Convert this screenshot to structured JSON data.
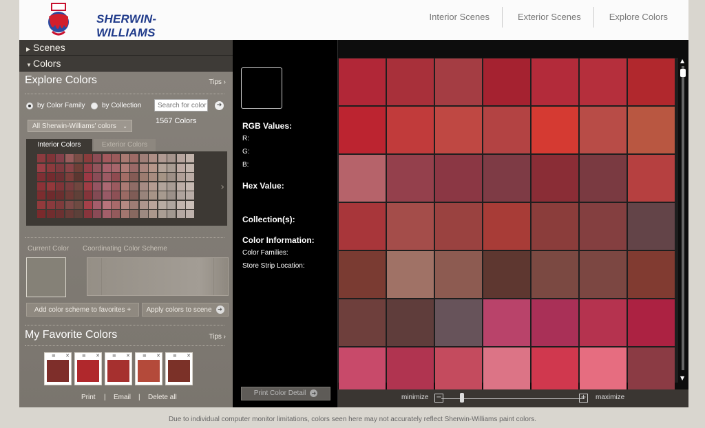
{
  "header": {
    "brand": "SHERWIN-WILLIAMS",
    "nav": [
      "Interior Scenes",
      "Exterior Scenes",
      "Explore Colors"
    ]
  },
  "left": {
    "accordion": [
      {
        "label": "Scenes",
        "expanded": false
      },
      {
        "label": "Colors",
        "expanded": true
      }
    ],
    "explore": {
      "title": "Explore Colors",
      "tips": "Tips",
      "radio_family": "by Color Family",
      "radio_collection": "by Collection",
      "search_placeholder": "Search for color",
      "select_value": "All Sherwin-Williams' colors",
      "count": "1567 Colors",
      "tab_interior": "Interior Colors",
      "tab_exterior": "Exterior Colors",
      "current_color_label": "Current Color",
      "scheme_label": "Coordinating Color Scheme",
      "btn_add": "Add color scheme to favorites",
      "btn_apply": "Apply colors to scene"
    },
    "favorites": {
      "title": "My Favorite Colors",
      "tips": "Tips",
      "colors": [
        "#7e2e2a",
        "#b0282c",
        "#a6302f",
        "#b44a3a",
        "#7b3128"
      ],
      "links": [
        "Print",
        "Email",
        "Delete all"
      ],
      "separator": "|"
    }
  },
  "info": {
    "rgb_title": "RGB Values:",
    "r": "R:",
    "g": "G:",
    "b": "B:",
    "hex_title": "Hex Value:",
    "collections_title": "Collection(s):",
    "color_info_title": "Color Information:",
    "families": "Color Families:",
    "strip": "Store Strip Location:",
    "print_button": "Print Color Detail"
  },
  "zoom": {
    "minimize": "minimize",
    "maximize": "maximize",
    "level": 0.15
  },
  "grid_colors": [
    [
      "#b12737",
      "#a8303a",
      "#a43d43",
      "#a52230",
      "#b32b3a",
      "#b52f3c",
      "#b1282d"
    ],
    [
      "#bc2430",
      "#c13b3b",
      "#bf4843",
      "#b34343",
      "#d53a32",
      "#b84c47",
      "#b95741"
    ],
    [
      "#b6636a",
      "#94404c",
      "#8b3744",
      "#7e3b45",
      "#8a2d36",
      "#7a3a41",
      "#b64040"
    ],
    [
      "#a8363a",
      "#a44d4a",
      "#9a4240",
      "#a83c37",
      "#8b3d3b",
      "#843f40",
      "#634448"
    ],
    [
      "#7a3b32",
      "#a07266",
      "#8d5b51",
      "#5e3730",
      "#7b4942",
      "#7c4742",
      "#813b31"
    ],
    [
      "#6e3f3c",
      "#5f3d3b",
      "#67535a",
      "#b9436a",
      "#a93057",
      "#b5334f",
      "#ac2242"
    ],
    [
      "#c84a6a",
      "#b03450",
      "#c44b5e",
      "#dc7486",
      "#d0384e",
      "#e66d80",
      "#8b3b44"
    ]
  ],
  "mini_grid_colors": [
    [
      "#8b3b3f",
      "#7f3438",
      "#83404a",
      "#985c5c",
      "#7a4c45",
      "#8a3c3c",
      "#8d4c55",
      "#a3595d",
      "#9a5b5b",
      "#a97a72",
      "#9e6b66",
      "#9f7f78",
      "#ad8e85",
      "#b09a92",
      "#a5948c",
      "#b7a59e",
      "#c1b2aa"
    ],
    [
      "#9a3f46",
      "#8c3a3d",
      "#7e3a3f",
      "#8a4448",
      "#6f3f37",
      "#943e47",
      "#92545c",
      "#a8616c",
      "#a6666b",
      "#b07c77",
      "#9a6967",
      "#a9857d",
      "#b59689",
      "#b3a398",
      "#a89c92",
      "#bdaaa3",
      "#c4b6ae"
    ],
    [
      "#7e2f34",
      "#742b2f",
      "#6c3033",
      "#7c3e3b",
      "#5c3630",
      "#9c3844",
      "#8a4c57",
      "#9c5a63",
      "#8f4b50",
      "#a36d66",
      "#855b55",
      "#9c7c70",
      "#a88c7f",
      "#a59485",
      "#9d8f86",
      "#b09f97",
      "#bbaca5"
    ],
    [
      "#8c3237",
      "#93383b",
      "#7f3438",
      "#7a3d3f",
      "#71463f",
      "#9f3d45",
      "#955462",
      "#ab6872",
      "#9b5a5f",
      "#aa7a74",
      "#8f6c66",
      "#a68c84",
      "#b59c91",
      "#b2a49b",
      "#a89c94",
      "#bcada6",
      "#c5b8b1"
    ],
    [
      "#7c2d2f",
      "#6f2b2d",
      "#6a2f2f",
      "#6e3a36",
      "#604038",
      "#84343a",
      "#834a54",
      "#985a66",
      "#8d5055",
      "#9a6a64",
      "#7f5c56",
      "#98847b",
      "#a79487",
      "#a79a8f",
      "#9b9089",
      "#afa39d",
      "#b8aca6"
    ],
    [
      "#923a3c",
      "#8a3a3d",
      "#7e3b3c",
      "#7d4a48",
      "#6e4a42",
      "#a64049",
      "#a45d6b",
      "#b7747b",
      "#a86a6a",
      "#b58a82",
      "#9e7d75",
      "#ae968d",
      "#baa59b",
      "#b8aca3",
      "#aea59e",
      "#c2b5ae",
      "#cbbfb8"
    ],
    [
      "#7a2a2c",
      "#712d2e",
      "#6b3131",
      "#683b37",
      "#5c4039",
      "#88353c",
      "#8a4a56",
      "#a35f6a",
      "#935a5c",
      "#a2766f",
      "#886960",
      "#9d8a81",
      "#ab988c",
      "#aa9e94",
      "#a19890",
      "#b4a8a2",
      "#beb2ac"
    ]
  ]
}
